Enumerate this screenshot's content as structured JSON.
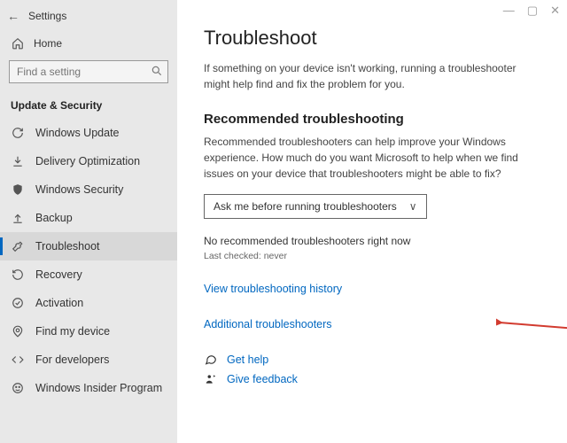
{
  "app_title": "Settings",
  "home_label": "Home",
  "search": {
    "placeholder": "Find a setting"
  },
  "category_header": "Update & Security",
  "sidebar": {
    "items": [
      {
        "label": "Windows Update"
      },
      {
        "label": "Delivery Optimization"
      },
      {
        "label": "Windows Security"
      },
      {
        "label": "Backup"
      },
      {
        "label": "Troubleshoot"
      },
      {
        "label": "Recovery"
      },
      {
        "label": "Activation"
      },
      {
        "label": "Find my device"
      },
      {
        "label": "For developers"
      },
      {
        "label": "Windows Insider Program"
      }
    ]
  },
  "main": {
    "title": "Troubleshoot",
    "intro": "If something on your device isn't working, running a troubleshooter might help find and fix the problem for you.",
    "section_heading": "Recommended troubleshooting",
    "section_text": "Recommended troubleshooters can help improve your Windows experience. How much do you want Microsoft to help when we find issues on your device that troubleshooters might be able to fix?",
    "dropdown_value": "Ask me before running troubleshooters",
    "status": "No recommended troubleshooters right now",
    "last_checked": "Last checked: never",
    "history_link": "View troubleshooting history",
    "additional_link": "Additional troubleshooters",
    "get_help": "Get help",
    "give_feedback": "Give feedback"
  },
  "window_controls": {
    "min": "—",
    "max": "▢",
    "close": "✕"
  }
}
